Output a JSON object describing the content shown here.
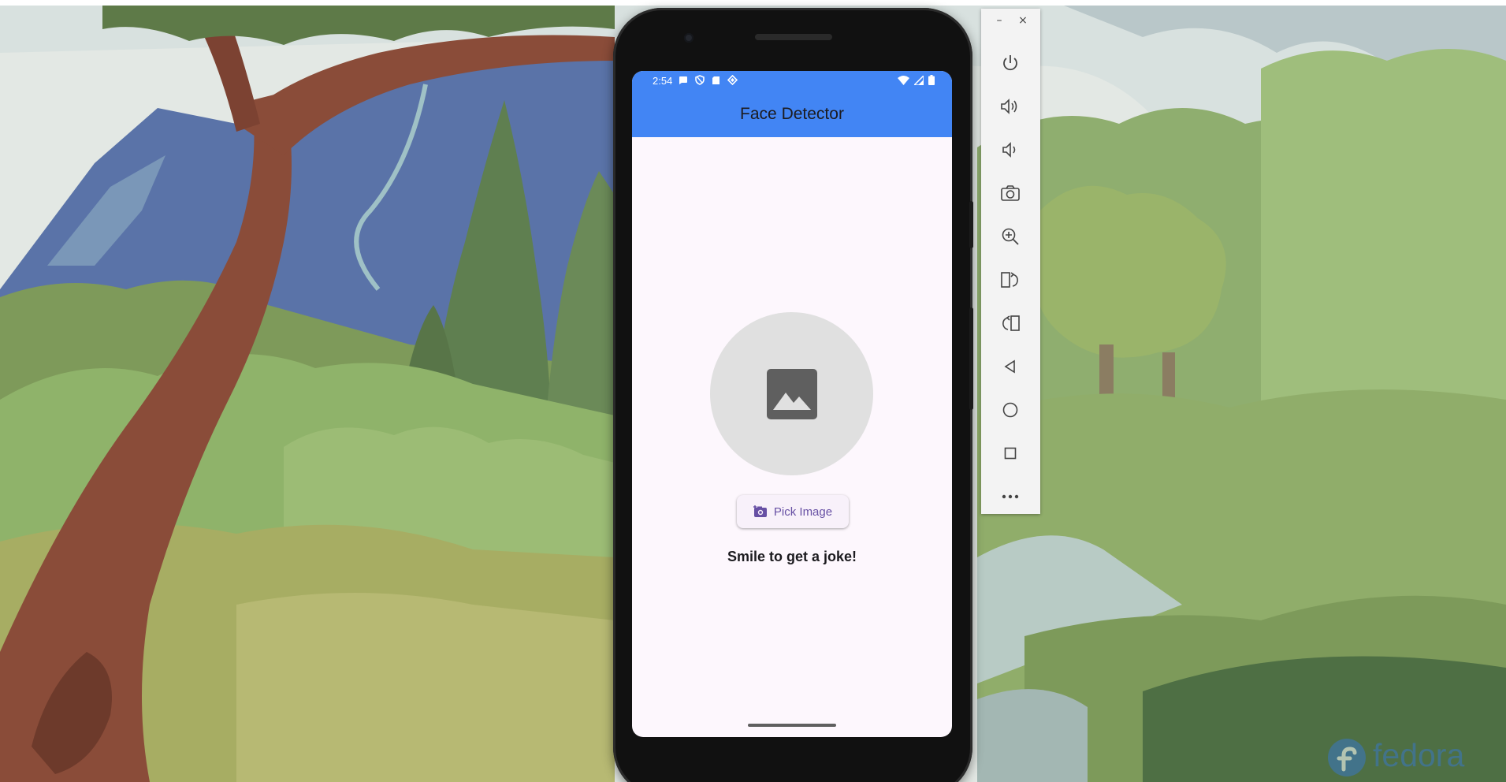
{
  "phone": {
    "status_bar": {
      "time": "2:54",
      "left_icons": [
        "chat-bubble-icon",
        "shield-icon",
        "sd-card-icon",
        "diamond-icon"
      ],
      "right_icons": [
        "wifi-icon",
        "cell-signal-icon",
        "battery-icon"
      ]
    },
    "app": {
      "title": "Face Detector",
      "image_placeholder_icon": "image-icon",
      "pick_button_label": "Pick Image",
      "pick_button_icon": "add-photo-icon",
      "message": "Smile to get a joke!",
      "accent_color": "#4285f4",
      "button_text_color": "#6750a4",
      "background_color": "#fdf7fd"
    }
  },
  "emulator_toolbar": {
    "window_controls": [
      "minimize",
      "close"
    ],
    "minimize_label": "–",
    "close_label": "×",
    "buttons": [
      "power",
      "volume-up",
      "volume-down",
      "screenshot",
      "zoom",
      "rotate-left",
      "rotate-right",
      "back",
      "home",
      "overview",
      "more"
    ]
  },
  "desktop": {
    "logo_text": "fedora"
  }
}
